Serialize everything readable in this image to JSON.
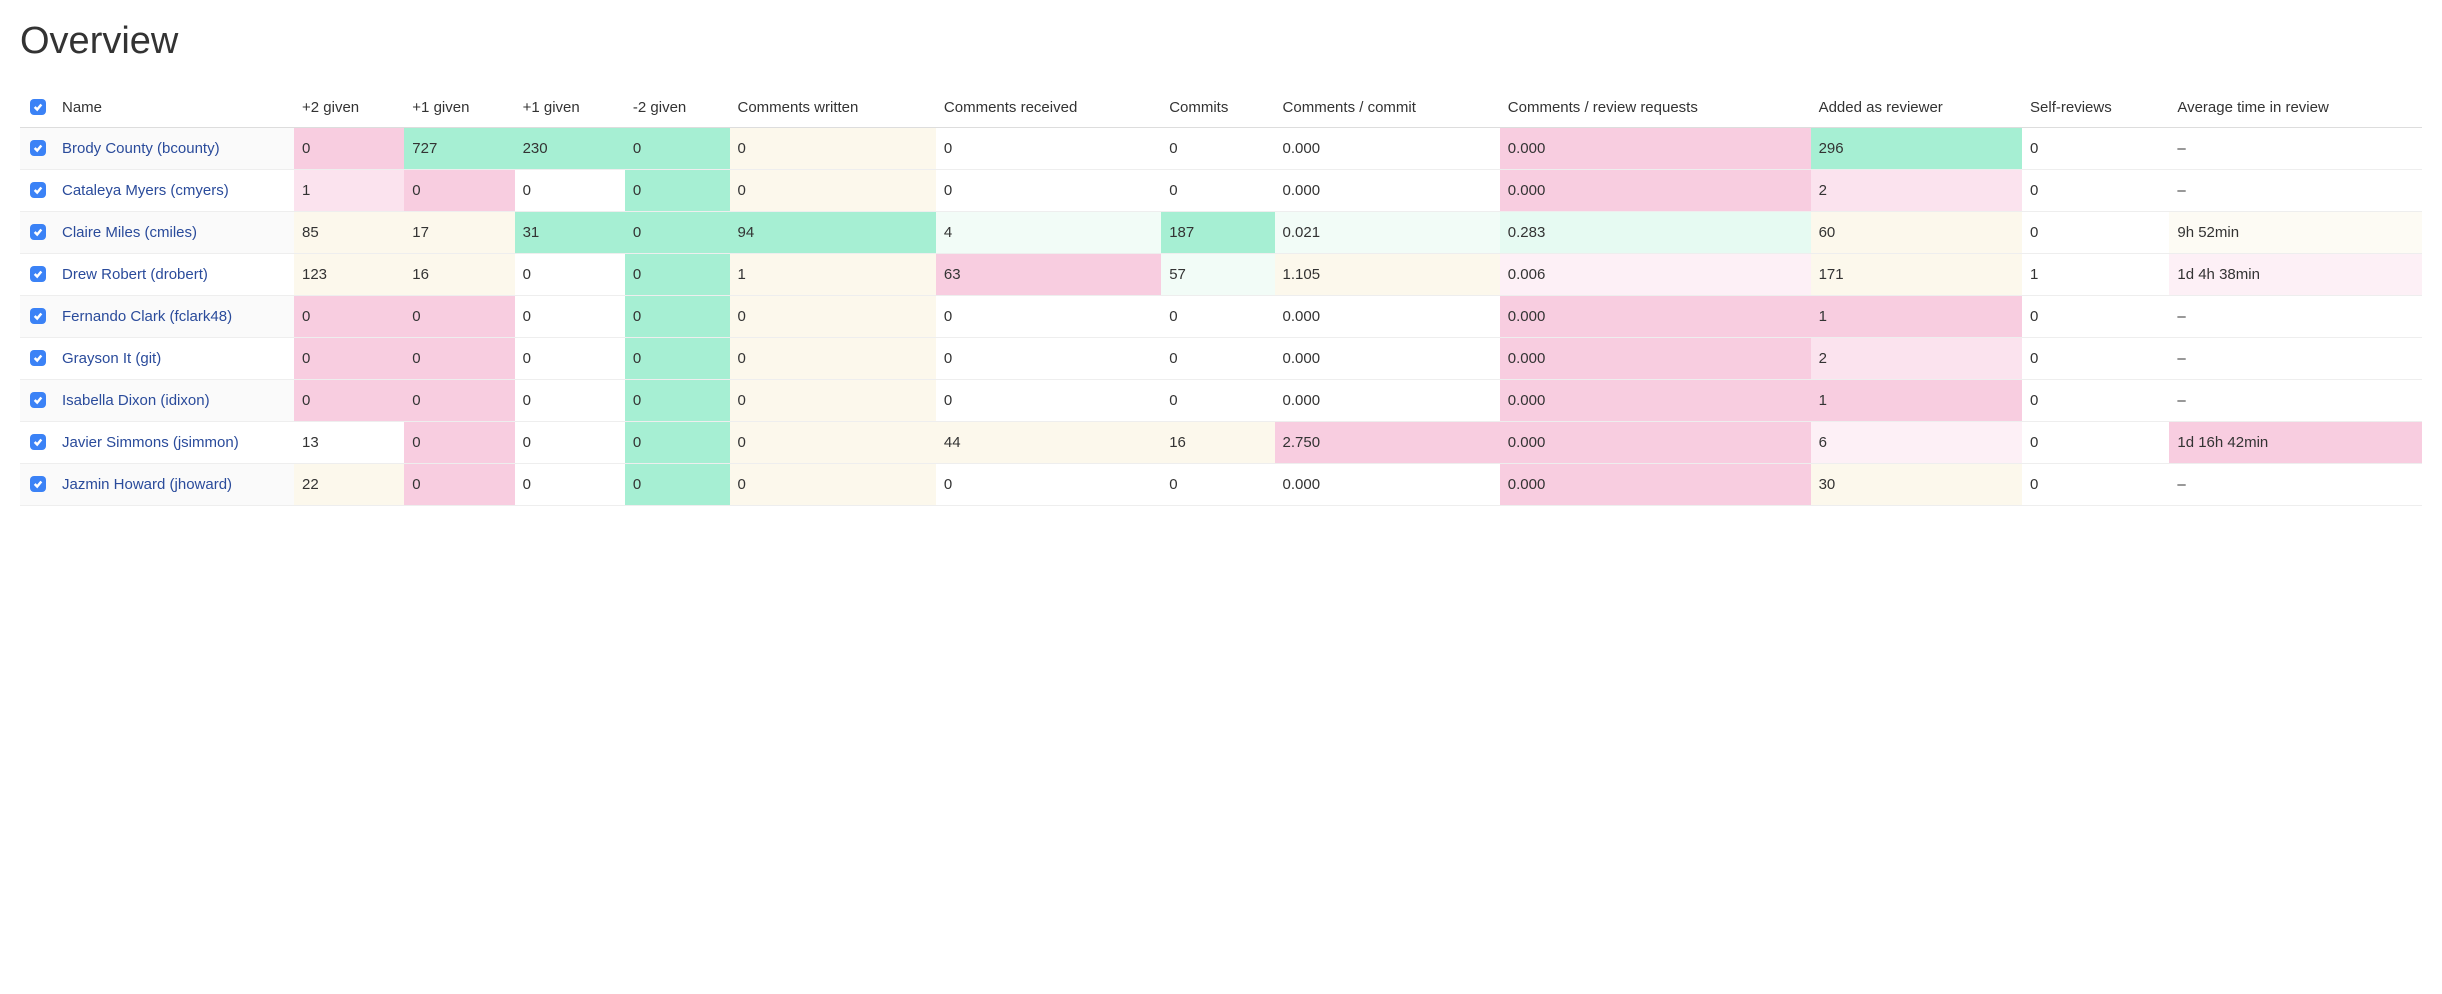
{
  "title": "Overview",
  "columns": [
    "Name",
    "+2 given",
    "+1 given",
    "+1 given",
    "-2 given",
    "Comments written",
    "Comments received",
    "Commits",
    "Comments / commit",
    "Comments / review requests",
    "Added as reviewer",
    "Self-reviews",
    "Average time in review"
  ],
  "rows": [
    {
      "name": "Brody County (bcounty)",
      "cells": [
        {
          "v": "0",
          "c": "c-pink-mid"
        },
        {
          "v": "727",
          "c": "c-mint-strong"
        },
        {
          "v": "230",
          "c": "c-mint-strong"
        },
        {
          "v": "0",
          "c": "c-mint-strong"
        },
        {
          "v": "0",
          "c": "c-cream"
        },
        {
          "v": "0",
          "c": "c-white"
        },
        {
          "v": "0",
          "c": "c-white"
        },
        {
          "v": "0.000",
          "c": "c-white"
        },
        {
          "v": "0.000",
          "c": "c-pink-mid"
        },
        {
          "v": "296",
          "c": "c-mint-strong"
        },
        {
          "v": "0",
          "c": "c-white"
        },
        {
          "v": "–",
          "c": "c-white"
        }
      ]
    },
    {
      "name": "Cataleya Myers (cmyers)",
      "cells": [
        {
          "v": "1",
          "c": "c-pink-light"
        },
        {
          "v": "0",
          "c": "c-pink-mid"
        },
        {
          "v": "0",
          "c": "c-white"
        },
        {
          "v": "0",
          "c": "c-mint-strong"
        },
        {
          "v": "0",
          "c": "c-cream"
        },
        {
          "v": "0",
          "c": "c-white"
        },
        {
          "v": "0",
          "c": "c-white"
        },
        {
          "v": "0.000",
          "c": "c-white"
        },
        {
          "v": "0.000",
          "c": "c-pink-mid"
        },
        {
          "v": "2",
          "c": "c-pink-light"
        },
        {
          "v": "0",
          "c": "c-white"
        },
        {
          "v": "–",
          "c": "c-white"
        }
      ]
    },
    {
      "name": "Claire Miles (cmiles)",
      "cells": [
        {
          "v": "85",
          "c": "c-cream"
        },
        {
          "v": "17",
          "c": "c-cream"
        },
        {
          "v": "31",
          "c": "c-mint-strong"
        },
        {
          "v": "0",
          "c": "c-mint-strong"
        },
        {
          "v": "94",
          "c": "c-mint-strong"
        },
        {
          "v": "4",
          "c": "c-mint-faint"
        },
        {
          "v": "187",
          "c": "c-mint-strong"
        },
        {
          "v": "0.021",
          "c": "c-mint-faint"
        },
        {
          "v": "0.283",
          "c": "c-mint-light"
        },
        {
          "v": "60",
          "c": "c-cream"
        },
        {
          "v": "0",
          "c": "c-white"
        },
        {
          "v": "9h 52min",
          "c": "c-cream-faint"
        }
      ]
    },
    {
      "name": "Drew Robert (drobert)",
      "cells": [
        {
          "v": "123",
          "c": "c-cream"
        },
        {
          "v": "16",
          "c": "c-cream"
        },
        {
          "v": "0",
          "c": "c-white"
        },
        {
          "v": "0",
          "c": "c-mint-strong"
        },
        {
          "v": "1",
          "c": "c-cream"
        },
        {
          "v": "63",
          "c": "c-pink-mid"
        },
        {
          "v": "57",
          "c": "c-mint-faint"
        },
        {
          "v": "1.105",
          "c": "c-cream"
        },
        {
          "v": "0.006",
          "c": "c-pink-faint"
        },
        {
          "v": "171",
          "c": "c-cream"
        },
        {
          "v": "1",
          "c": "c-white"
        },
        {
          "v": "1d 4h 38min",
          "c": "c-pink-faint"
        }
      ]
    },
    {
      "name": "Fernando Clark (fclark48)",
      "cells": [
        {
          "v": "0",
          "c": "c-pink-mid"
        },
        {
          "v": "0",
          "c": "c-pink-mid"
        },
        {
          "v": "0",
          "c": "c-white"
        },
        {
          "v": "0",
          "c": "c-mint-strong"
        },
        {
          "v": "0",
          "c": "c-cream"
        },
        {
          "v": "0",
          "c": "c-white"
        },
        {
          "v": "0",
          "c": "c-white"
        },
        {
          "v": "0.000",
          "c": "c-white"
        },
        {
          "v": "0.000",
          "c": "c-pink-mid"
        },
        {
          "v": "1",
          "c": "c-pink-mid"
        },
        {
          "v": "0",
          "c": "c-white"
        },
        {
          "v": "–",
          "c": "c-white"
        }
      ]
    },
    {
      "name": "Grayson It (git)",
      "cells": [
        {
          "v": "0",
          "c": "c-pink-mid"
        },
        {
          "v": "0",
          "c": "c-pink-mid"
        },
        {
          "v": "0",
          "c": "c-white"
        },
        {
          "v": "0",
          "c": "c-mint-strong"
        },
        {
          "v": "0",
          "c": "c-cream"
        },
        {
          "v": "0",
          "c": "c-white"
        },
        {
          "v": "0",
          "c": "c-white"
        },
        {
          "v": "0.000",
          "c": "c-white"
        },
        {
          "v": "0.000",
          "c": "c-pink-mid"
        },
        {
          "v": "2",
          "c": "c-pink-light"
        },
        {
          "v": "0",
          "c": "c-white"
        },
        {
          "v": "–",
          "c": "c-white"
        }
      ]
    },
    {
      "name": "Isabella Dixon (idixon)",
      "cells": [
        {
          "v": "0",
          "c": "c-pink-mid"
        },
        {
          "v": "0",
          "c": "c-pink-mid"
        },
        {
          "v": "0",
          "c": "c-white"
        },
        {
          "v": "0",
          "c": "c-mint-strong"
        },
        {
          "v": "0",
          "c": "c-cream"
        },
        {
          "v": "0",
          "c": "c-white"
        },
        {
          "v": "0",
          "c": "c-white"
        },
        {
          "v": "0.000",
          "c": "c-white"
        },
        {
          "v": "0.000",
          "c": "c-pink-mid"
        },
        {
          "v": "1",
          "c": "c-pink-mid"
        },
        {
          "v": "0",
          "c": "c-white"
        },
        {
          "v": "–",
          "c": "c-white"
        }
      ]
    },
    {
      "name": "Javier Simmons (jsimmon)",
      "cells": [
        {
          "v": "13",
          "c": "c-white"
        },
        {
          "v": "0",
          "c": "c-pink-mid"
        },
        {
          "v": "0",
          "c": "c-white"
        },
        {
          "v": "0",
          "c": "c-mint-strong"
        },
        {
          "v": "0",
          "c": "c-cream"
        },
        {
          "v": "44",
          "c": "c-cream"
        },
        {
          "v": "16",
          "c": "c-cream"
        },
        {
          "v": "2.750",
          "c": "c-pink-mid"
        },
        {
          "v": "0.000",
          "c": "c-pink-mid"
        },
        {
          "v": "6",
          "c": "c-pink-faint"
        },
        {
          "v": "0",
          "c": "c-white"
        },
        {
          "v": "1d 16h 42min",
          "c": "c-pink-mid"
        }
      ]
    },
    {
      "name": "Jazmin Howard (jhoward)",
      "cells": [
        {
          "v": "22",
          "c": "c-cream"
        },
        {
          "v": "0",
          "c": "c-pink-mid"
        },
        {
          "v": "0",
          "c": "c-white"
        },
        {
          "v": "0",
          "c": "c-mint-strong"
        },
        {
          "v": "0",
          "c": "c-cream"
        },
        {
          "v": "0",
          "c": "c-white"
        },
        {
          "v": "0",
          "c": "c-white"
        },
        {
          "v": "0.000",
          "c": "c-white"
        },
        {
          "v": "0.000",
          "c": "c-pink-mid"
        },
        {
          "v": "30",
          "c": "c-cream"
        },
        {
          "v": "0",
          "c": "c-white"
        },
        {
          "v": "–",
          "c": "c-white"
        }
      ]
    }
  ]
}
